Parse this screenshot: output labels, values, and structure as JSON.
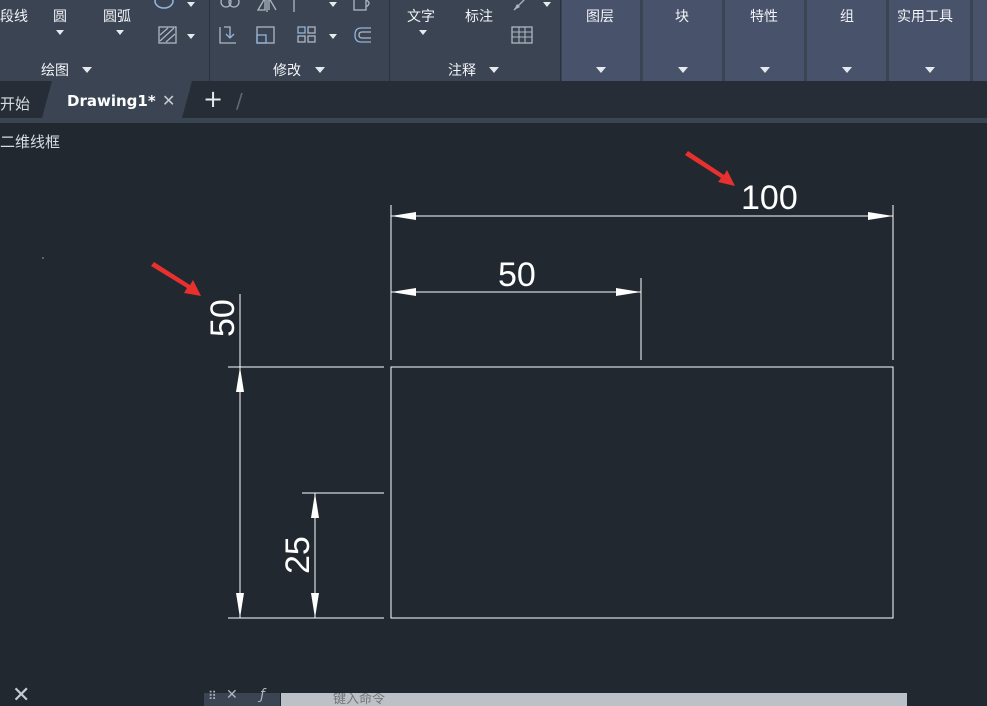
{
  "ribbon": {
    "draw": {
      "polyline_label": "段线",
      "circle_label": "圆",
      "arc_label": "圆弧",
      "title": "绘图"
    },
    "modify": {
      "title": "修改"
    },
    "annotation": {
      "text_label": "文字",
      "dimension_label": "标注",
      "title": "注释"
    },
    "collapsed_panels": [
      "图层",
      "块",
      "特性",
      "组",
      "实用工具"
    ]
  },
  "tabs": {
    "start": "开始",
    "active": "Drawing1*"
  },
  "viewport": {
    "label": "二维线框"
  },
  "dimensions": {
    "top_overall": "100",
    "top_partial": "50",
    "left_upper": "50",
    "left_lower": "25"
  },
  "colors": {
    "background": "#212830",
    "ribbon": "#3b4453",
    "geometry": "#ffffff",
    "arrow_marker": "#e8302f"
  },
  "command_line": {
    "placeholder": "键入命令"
  }
}
